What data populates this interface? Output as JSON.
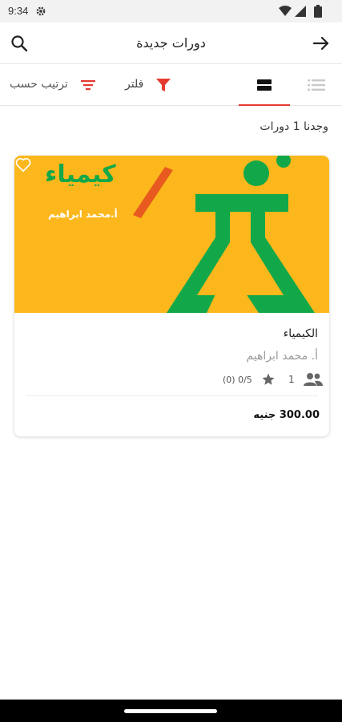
{
  "status_bar": {
    "time": "9:34",
    "icons": [
      "gear-icon",
      "wifi-icon",
      "signal-icon",
      "battery-icon"
    ]
  },
  "header": {
    "title": "دورات جديدة",
    "back_icon": "arrow-right-icon",
    "search_icon": "search-icon"
  },
  "toolbar": {
    "views": [
      "list-view-icon",
      "card-view-icon"
    ],
    "active_view": "card-view-icon",
    "filter_label": "فلتر",
    "sort_label": "ترتيب حسب"
  },
  "results": {
    "text": "وجدنا 1 دورات"
  },
  "course": {
    "thumbnail_title": "كيمياء",
    "thumbnail_teacher": "أ.محمد ابراهيم",
    "name": "الكيمياء",
    "teacher": "أ. محمد ابراهيم",
    "students": "1",
    "rating": "(0) 0/5",
    "price": "300.00 جنيه"
  },
  "colors": {
    "accent": "#e53a2f",
    "thumb_yellow": "#fbb71c",
    "thumb_green": "#12a84a"
  }
}
